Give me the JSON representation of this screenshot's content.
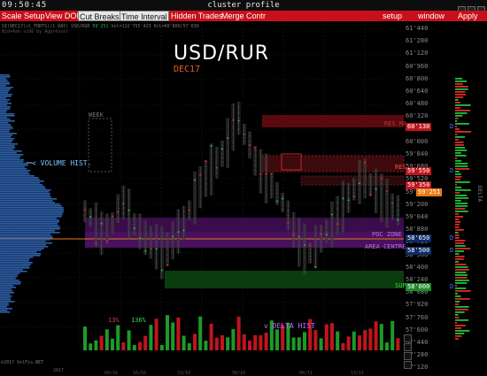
{
  "window": {
    "clock": "09:50:45",
    "title": "cluster profile"
  },
  "menu": {
    "left": [
      "Scale Setup",
      "View DOM",
      "Cut Breaks",
      "Time Interval",
      "Hidden Trades",
      "Merge Contr"
    ],
    "right": [
      "setup",
      "window",
      "Apply"
    ],
    "active": [
      "Cut Breaks",
      "Time Interval"
    ]
  },
  "chart": {
    "symbol": "USD/RUR",
    "expiry": "DEC17",
    "info_line1": "SI(DEC17)(C_FORTS)(1 DAY) USD/RUR",
    "info_line1_last": "59'251",
    "info_line1_rest": "Vol=112'755'423 H/L=60'800/57'630",
    "info_line2": "Bid+Ask side by Aggressor",
    "labels": {
      "week": "WEEK",
      "volume_hist": "< VOLUME HIST.",
      "delta_hist": "v DELTA HIST",
      "res": "RES",
      "sup": "SUP",
      "res_top": "RES MA",
      "poc": "POC ZONE",
      "area": "AREA CENTRE",
      "pct_red": "13%",
      "pct_green": "136%",
      "copyright": "©2017 VolFix.NET",
      "dates": [
        "2017",
        "09/10",
        "16/10",
        "23/10",
        "30/10",
        "06/11",
        "13/11"
      ]
    },
    "price_ticks": [
      "61'440",
      "61'280",
      "61'120",
      "60'960",
      "60'800",
      "60'640",
      "60'480",
      "60'320",
      "60'160",
      "60'000",
      "59'840",
      "59'680",
      "59'520",
      "59'360",
      "59'200",
      "59'040",
      "58'880",
      "58'720",
      "58'560",
      "58'400",
      "58'240",
      "58'080",
      "57'920",
      "57'760",
      "57'600",
      "57'440",
      "57'280",
      "57'120"
    ],
    "badges": [
      {
        "value": "60'130",
        "style": "red",
        "d": true
      },
      {
        "value": "59'550",
        "style": "red",
        "d": true
      },
      {
        "value": "59'350",
        "style": "red",
        "d": false
      },
      {
        "value": "59'251",
        "style": "orange",
        "d": false
      },
      {
        "value": "58'650",
        "style": "blue",
        "d": true
      },
      {
        "value": "58'500",
        "style": "blue",
        "d": true
      },
      {
        "value": "58'000",
        "style": "green",
        "d": true
      }
    ],
    "side_label": "DELTA",
    "colors": {
      "menu_red": "#c8101a",
      "res_zone": "#6a0c10",
      "sup_zone": "#0d5a14",
      "poc_zone": "#5a1470",
      "volume_hist": "#2d5fa8",
      "last_price": "#e87a1a"
    }
  }
}
